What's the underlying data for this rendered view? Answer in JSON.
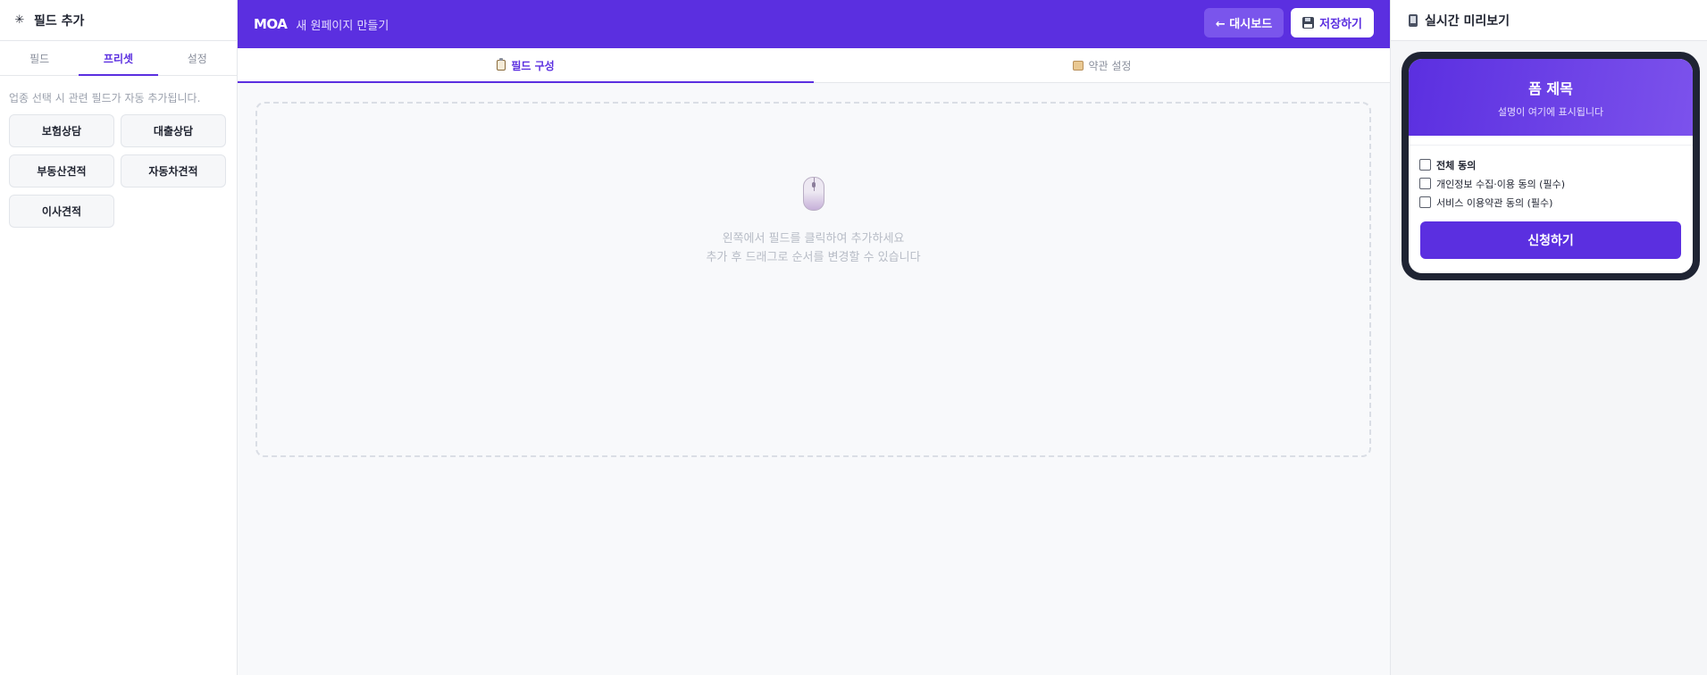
{
  "left": {
    "title": "필드 추가",
    "tabs": [
      "필드",
      "프리셋",
      "설정"
    ],
    "active_tab": 1,
    "hint": "업종 선택 시 관련 필드가 자동 추가됩니다.",
    "presets": [
      "보험상담",
      "대출상담",
      "부동산견적",
      "자동차견적",
      "이사견적"
    ]
  },
  "topbar": {
    "logo": "MOA",
    "subtitle": "새 원페이지 만들기",
    "dashboard_label": "← 대시보드",
    "save_label": "저장하기",
    "bg_color": "#5b2fe0"
  },
  "center": {
    "tabs": [
      {
        "label": "필드 구성",
        "icon": "clipboard-icon"
      },
      {
        "label": "약관 설정",
        "icon": "scroll-icon"
      }
    ],
    "active_tab": 0,
    "empty_line1": "왼쪽에서 필드를 클릭하여 추가하세요",
    "empty_line2": "추가 후 드래그로 순서를 변경할 수 있습니다"
  },
  "preview": {
    "title": "실시간 미리보기",
    "form_title": "폼 제목",
    "form_desc": "설명이 여기에 표시됩니다",
    "consents": [
      {
        "label": "전체 동의",
        "checked": false
      },
      {
        "label": "개인정보 수집·이용 동의 (필수)",
        "checked": false
      },
      {
        "label": "서비스 이용약관 동의 (필수)",
        "checked": false
      }
    ],
    "submit_label": "신청하기"
  }
}
